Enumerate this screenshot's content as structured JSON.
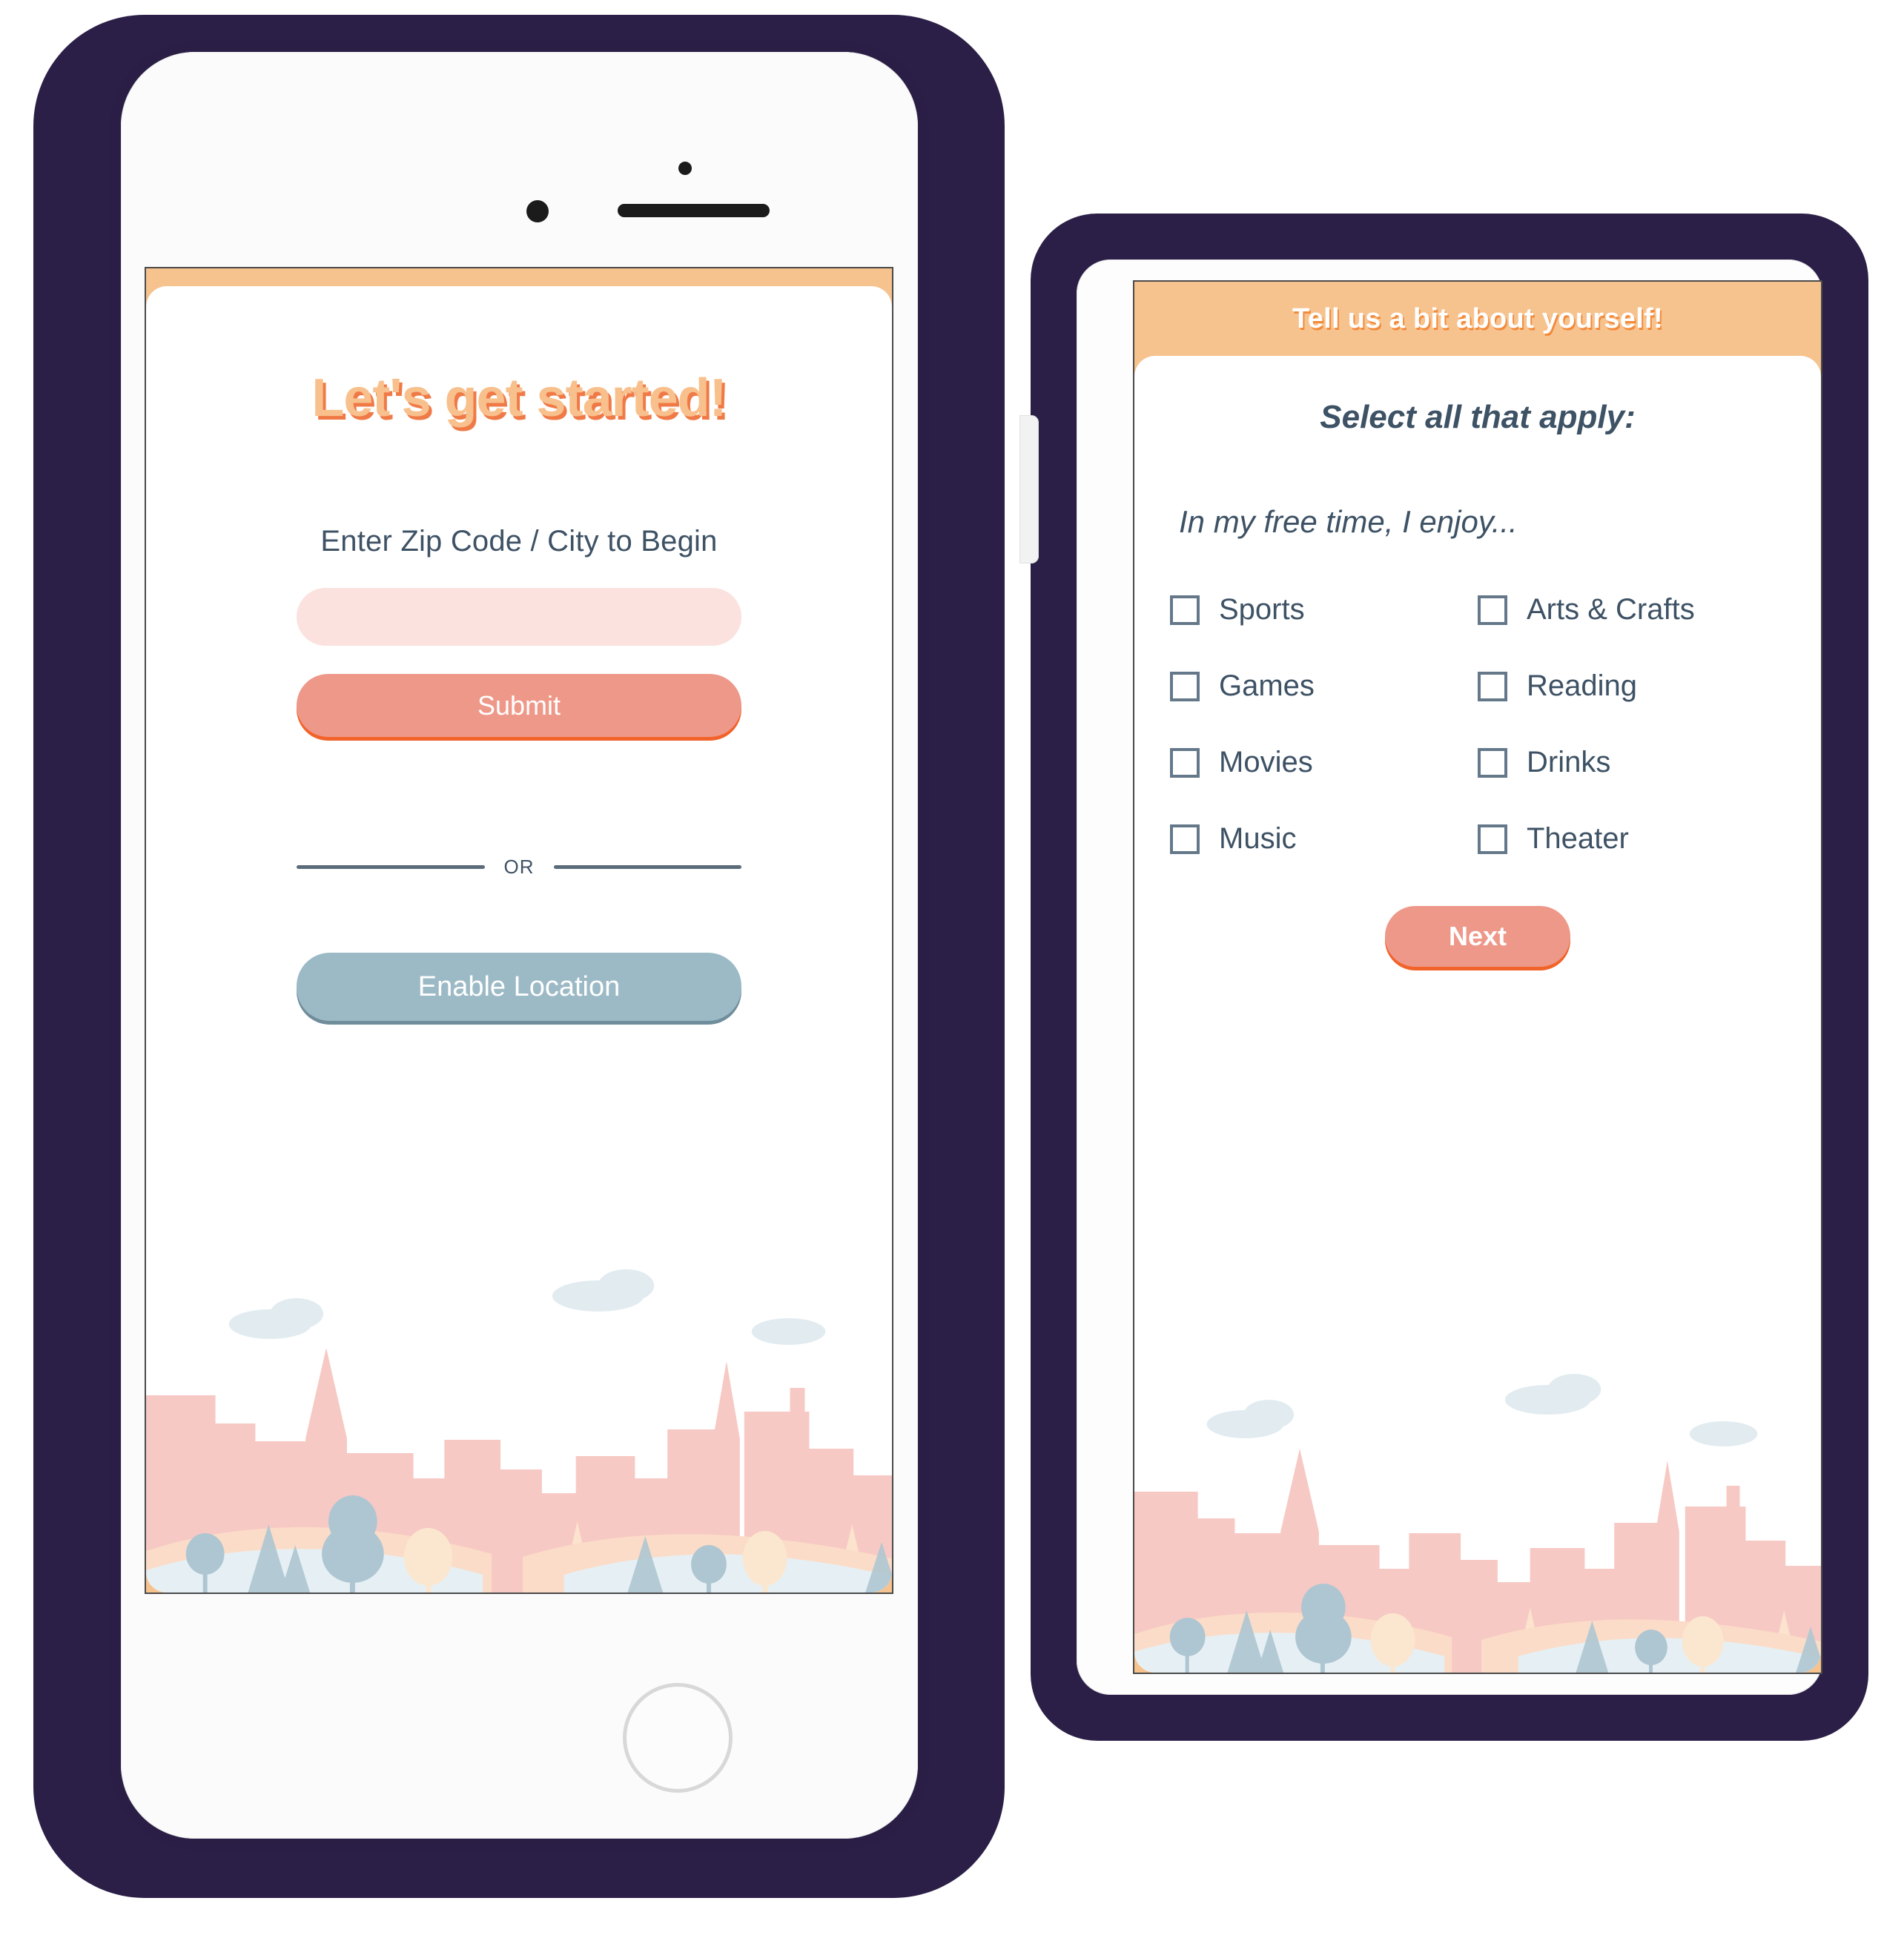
{
  "palette": {
    "frame_navy": "#2B1F47",
    "header_orange": "#F6C38F",
    "accent_orange": "#F07A47",
    "title_orange": "#F8C08C",
    "salmon": "#EE9889",
    "salmon_edge": "#F2632A",
    "blue_gray": "#9CBAC6",
    "blue_gray_edge": "#6F8D9B",
    "slate_text": "#3E5265",
    "input_pink": "#FBE2DE",
    "divider": "#5A6B7A",
    "building_pink": "#F7C9C4",
    "tree_blue": "#AEC6D2",
    "tree_cream": "#FBE7CF",
    "cloud_blue": "#E2ECF0",
    "ground_blue": "#E6F0F4",
    "ground_peach": "#FBDCC8"
  },
  "screen_left": {
    "header_title": "",
    "title": "Let's get started!",
    "field_label": "Enter Zip Code / City to Begin",
    "zip_input": {
      "value": "",
      "placeholder": ""
    },
    "submit_label": "Submit",
    "or_label": "OR",
    "enable_location_label": "Enable Location"
  },
  "screen_right": {
    "header_title": "Tell us a bit about yourself!",
    "sub_title": "Select all that apply:",
    "prompt": "In my free time, I enjoy...",
    "options": [
      {
        "label": "Sports",
        "checked": false
      },
      {
        "label": "Arts & Crafts",
        "checked": false
      },
      {
        "label": "Games",
        "checked": false
      },
      {
        "label": "Reading",
        "checked": false
      },
      {
        "label": "Movies",
        "checked": false
      },
      {
        "label": "Drinks",
        "checked": false
      },
      {
        "label": "Music",
        "checked": false
      },
      {
        "label": "Theater",
        "checked": false
      }
    ],
    "next_label": "Next"
  }
}
